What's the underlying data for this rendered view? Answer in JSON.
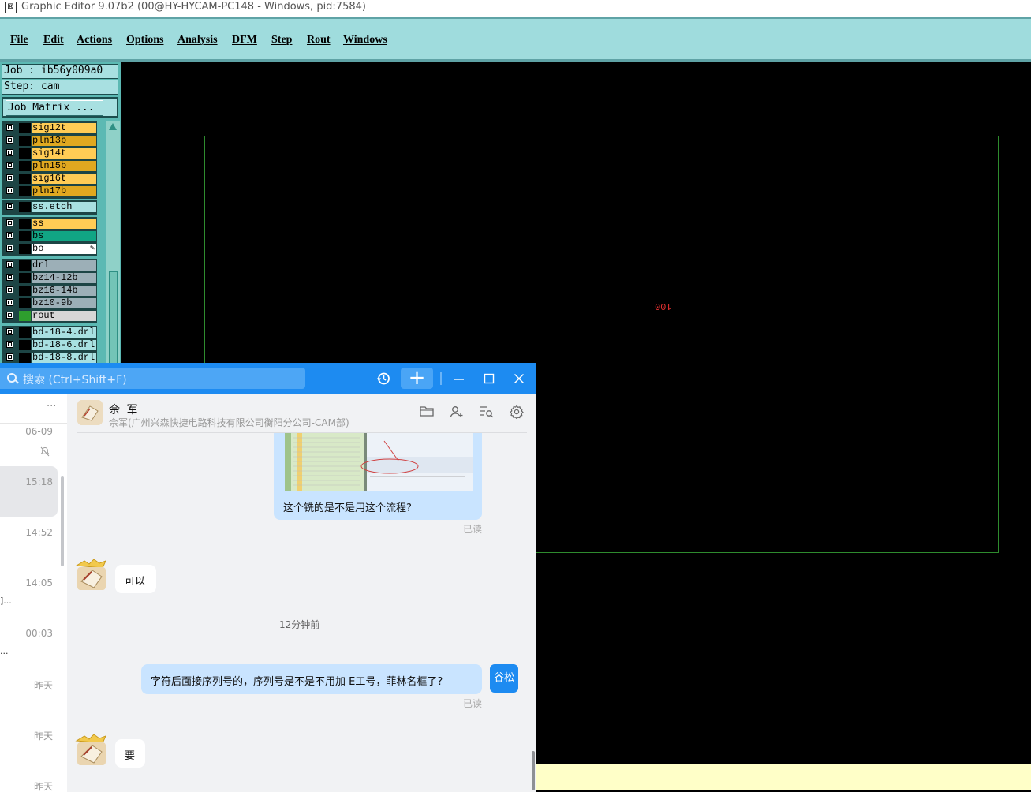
{
  "titlebar": {
    "title": "Graphic Editor 9.07b2 (00@HY-HYCAM-PC148 - Windows, pid:7584)"
  },
  "menu": {
    "items": [
      "File",
      "Edit",
      "Actions",
      "Options",
      "Analysis",
      "DFM",
      "Step",
      "Rout",
      "Windows"
    ]
  },
  "job": {
    "job_line": "Job : ib56y009a0",
    "step_line": "Step: cam",
    "matrix_button": "Job Matrix ..."
  },
  "layers": [
    {
      "name": "sig12t",
      "color": "#ffcc55"
    },
    {
      "name": "pln13b",
      "color": "#e0a820"
    },
    {
      "name": "sig14t",
      "color": "#ffcc55"
    },
    {
      "name": "pln15b",
      "color": "#e0a820"
    },
    {
      "name": "sig16t",
      "color": "#ffcc55"
    },
    {
      "name": "pln17b",
      "color": "#e0a820"
    },
    {
      "name": "ss.etch",
      "color": "#a8e0e1"
    },
    {
      "name": "ss",
      "color": "#ffcc55"
    },
    {
      "name": "bs",
      "color": "#11a584"
    },
    {
      "name": "bo",
      "color": "#ffffff"
    },
    {
      "name": "drl",
      "color": "#9cafb7"
    },
    {
      "name": "bz14-12b",
      "color": "#9cafb7"
    },
    {
      "name": "bz16-14b",
      "color": "#9cafb7"
    },
    {
      "name": "bz10-9b",
      "color": "#9cafb7"
    },
    {
      "name": "rout",
      "color": "#d6d6d6"
    },
    {
      "name": "bd-18-4.drl",
      "color": "#a8e0e1"
    },
    {
      "name": "bd-18-6.drl",
      "color": "#a8e0e1"
    },
    {
      "name": "bd-18-8.drl",
      "color": "#a8e0e1"
    }
  ],
  "canvas": {
    "board_label": "100",
    "board_outline_color": "#2e8b2e",
    "label_color": "#e03030"
  },
  "chat": {
    "search_placeholder": "搜索 (Ctrl+Shift+F)",
    "list_more": "···",
    "list_times": [
      "06-09",
      "15:18",
      "14:52",
      "14:05",
      "00:03",
      "昨天",
      "昨天",
      "昨天"
    ],
    "list_truncated": [
      "]...",
      "..."
    ],
    "contact_name": "佘 军",
    "contact_org": "佘军(广州兴森快捷电路科技有限公司衡阳分公司-CAM部)",
    "messages": {
      "m1_text": "这个铣的是不是用这个流程?",
      "m1_read": "已读",
      "m2_text": "可以",
      "time_sep": "12分钟前",
      "m3_text": "字符后面接序列号的，序列号是不是不用加 E工号，菲林名框了?",
      "m3_read": "已读",
      "m3_avatar": "谷松",
      "m4_text": "要"
    },
    "accent": "#1d8bf1"
  }
}
